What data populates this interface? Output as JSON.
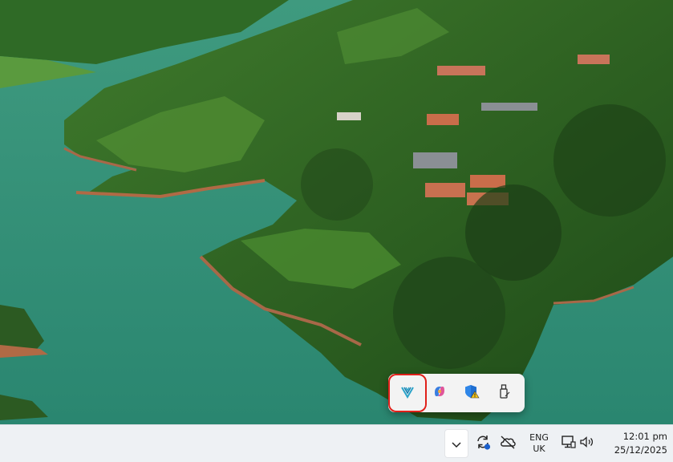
{
  "taskbar": {
    "language": {
      "line1": "ENG",
      "line2": "UK"
    },
    "clock": {
      "time": "12:01 pm",
      "date": "25/12/2025"
    }
  },
  "tray_flyout": {
    "items": [
      {
        "icon": "vpn-app-icon",
        "selected": true
      },
      {
        "icon": "copilot-icon"
      },
      {
        "icon": "windows-security-warning-icon"
      },
      {
        "icon": "usb-drive-icon"
      }
    ]
  },
  "colors": {
    "highlight_outline": "#e0201a",
    "taskbar_bg": "#eef1f4",
    "flyout_bg": "#f3f3f3"
  }
}
